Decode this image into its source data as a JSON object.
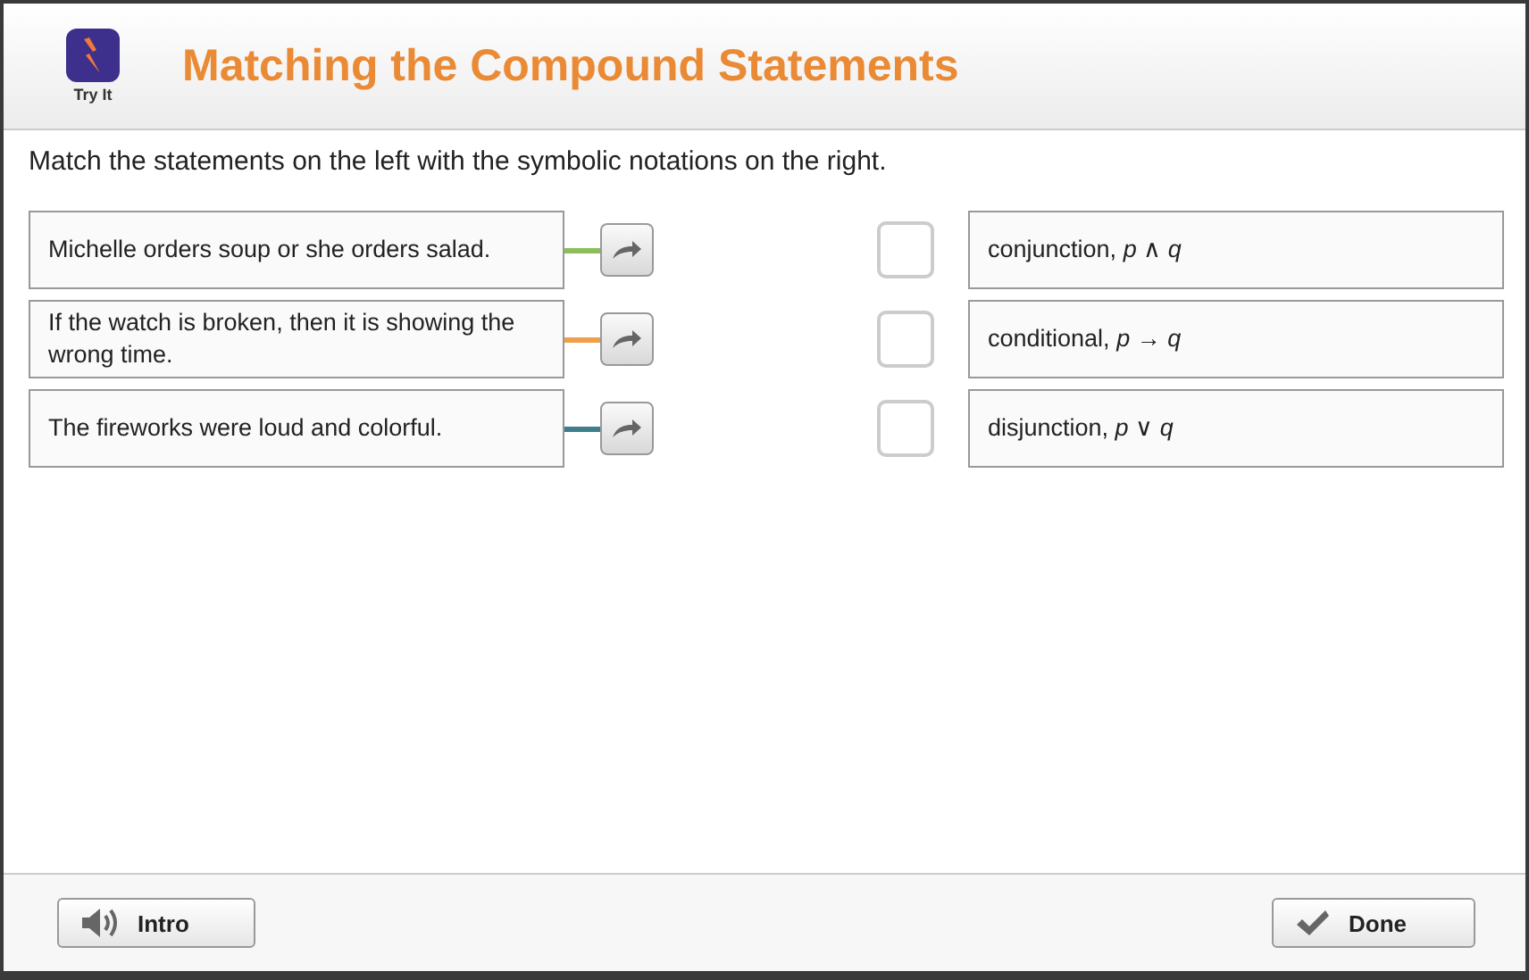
{
  "header": {
    "badge": "Try It",
    "title": "Matching the Compound Statements"
  },
  "instruction": "Match the statements on the left with the symbolic notations on the right.",
  "statements": [
    {
      "text": "Michelle orders soup or she orders salad.",
      "color": "#8cbf5a"
    },
    {
      "text": "If the watch is broken, then it is showing the wrong time.",
      "color": "#f0a04b"
    },
    {
      "text": "The fireworks were loud and colorful.",
      "color": "#3f7f8c"
    }
  ],
  "notations": [
    {
      "text": "conjunction, *p* ∧ *q*",
      "checked": false
    },
    {
      "text": "conditional, *p* → *q*",
      "checked": false
    },
    {
      "text": "disjunction, *p* ∨ *q*",
      "checked": false
    }
  ],
  "footer": {
    "intro": "Intro",
    "done": "Done"
  }
}
